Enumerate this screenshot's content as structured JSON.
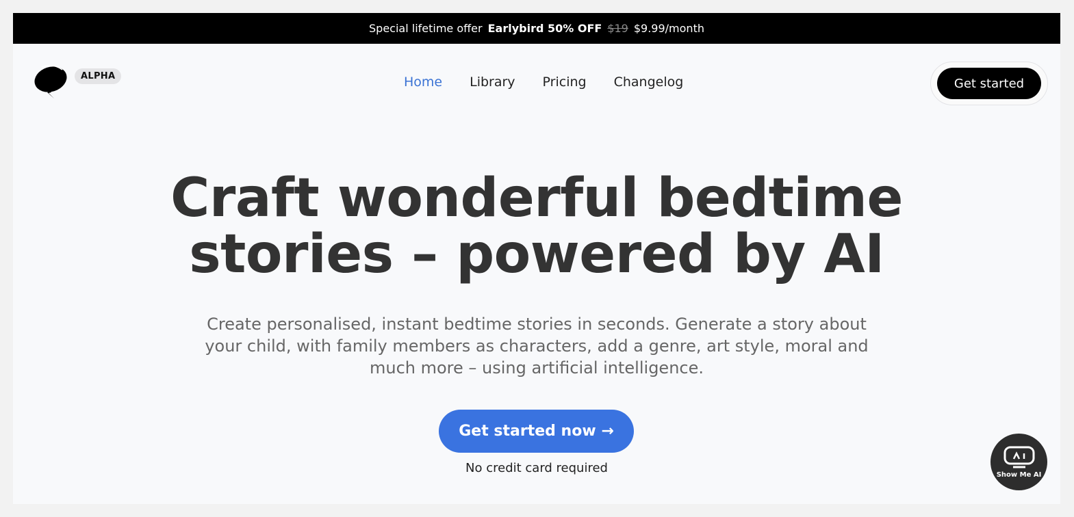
{
  "promo": {
    "lead": "Special lifetime offer",
    "highlight": "Earlybird 50% OFF",
    "old_price": "$19",
    "new_price": "$9.99/month"
  },
  "brand": {
    "logo_icon": "speech-bubble-lightning-icon",
    "badge": "ALPHA"
  },
  "nav": {
    "items": [
      {
        "label": "Home",
        "active": true
      },
      {
        "label": "Library",
        "active": false
      },
      {
        "label": "Pricing",
        "active": false
      },
      {
        "label": "Changelog",
        "active": false
      }
    ],
    "cta_label": "Get started"
  },
  "hero": {
    "title_line1": "Craft wonderful bedtime",
    "title_line2": "stories – powered by AI",
    "subtitle": "Create personalised, instant bedtime stories in seconds. Generate a story about your child, with family members as characters, add a genre, art style, moral and much more – using artificial intelligence.",
    "cta_label": "Get started now →",
    "note": "No credit card required"
  },
  "widget": {
    "label": "Show Me AI",
    "icon": "robot-face-icon"
  },
  "colors": {
    "accent": "#3a73e0",
    "nav_active": "#3b73d4",
    "promo_bg": "#000000"
  }
}
